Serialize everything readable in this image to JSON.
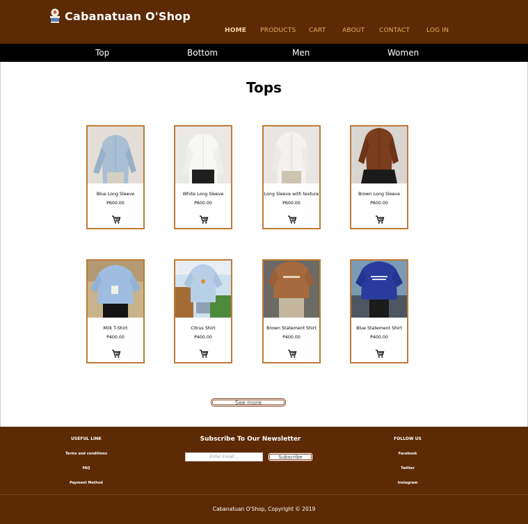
{
  "brand": {
    "name": "Cabanatuan O'Shop"
  },
  "nav": [
    {
      "label": "HOME",
      "active": true
    },
    {
      "label": "PRODUCTS"
    },
    {
      "label": "CART"
    },
    {
      "label": "ABOUT"
    },
    {
      "label": "CONTACT"
    },
    {
      "label": "LOG IN"
    }
  ],
  "categories": [
    "Top",
    "Bottom",
    "Men",
    "Women"
  ],
  "page_title": "Tops",
  "products": [
    {
      "name": "Blue Long Sleeve",
      "price": "P600.00"
    },
    {
      "name": "White Long Sleeve",
      "price": "P600.00"
    },
    {
      "name": "Long Sleeve with texture",
      "price": "P600.00"
    },
    {
      "name": "Brown Long Sleeve",
      "price": "P600.00"
    },
    {
      "name": "Milk T-Shirt",
      "price": "P400.00"
    },
    {
      "name": "Citrus Shirt",
      "price": "P400.00"
    },
    {
      "name": "Brown Statement Shirt",
      "price": "P400.00"
    },
    {
      "name": "Blue Statement Shirt",
      "price": "P400.00"
    }
  ],
  "icons": {
    "cart": "shopping-cart-icon",
    "logo": "shop-logo-icon"
  },
  "see_more": "See more",
  "footer": {
    "useful_title": "USEFUL LINK",
    "useful_links": [
      "Terms and conditions",
      "FAQ",
      "Payment Method"
    ],
    "newsletter_title": "Subscribe To Our Newsletter",
    "email_placeholder": "Enter Email...",
    "subscribe_label": "Subscribe",
    "follow_title": "FOLLOW US",
    "follow_links": [
      "Facebook",
      "Twitter",
      "Instagram"
    ],
    "copyright": "Cabanatuan O'Shop, Copyright © 2019"
  },
  "colors": {
    "header_bg": "#5c2a04",
    "category_bar_bg": "#000000",
    "card_border": "#c07a36",
    "nav_text": "#e3b062"
  }
}
